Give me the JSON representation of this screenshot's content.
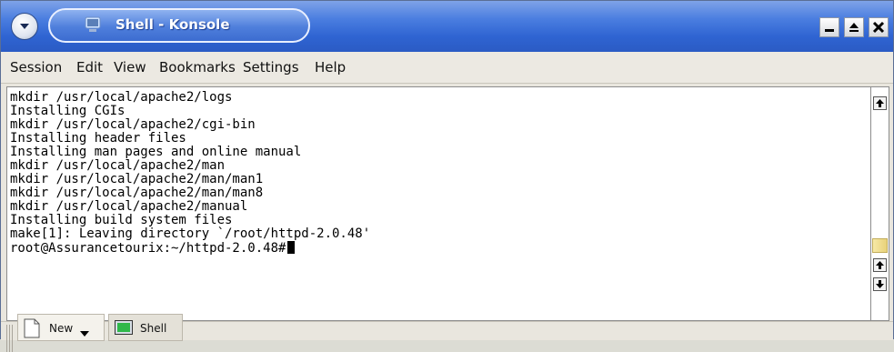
{
  "window": {
    "title": "Shell - Konsole",
    "controls": [
      "minimize",
      "maximize",
      "close"
    ]
  },
  "menu": {
    "items": [
      "Session",
      "Edit",
      "View",
      "Bookmarks",
      "Settings",
      "Help"
    ]
  },
  "terminal": {
    "lines": [
      "mkdir /usr/local/apache2/logs",
      "Installing CGIs",
      "mkdir /usr/local/apache2/cgi-bin",
      "Installing header files",
      "Installing man pages and online manual",
      "mkdir /usr/local/apache2/man",
      "mkdir /usr/local/apache2/man/man1",
      "mkdir /usr/local/apache2/man/man8",
      "mkdir /usr/local/apache2/manual",
      "Installing build system files",
      "make[1]: Leaving directory `/root/httpd-2.0.48'"
    ],
    "prompt": "root@Assurancetourix:~/httpd-2.0.48#"
  },
  "tabs": {
    "new_label": "New",
    "shell_label": "Shell"
  },
  "icons": {
    "menu": "circle-arrow-down-icon",
    "app": "konsole-icon",
    "new": "new-document-icon",
    "shell": "terminal-icon"
  },
  "colors": {
    "titlebar": "#3a6bd4",
    "menubar": "#ece9e2",
    "terminal_bg": "#ffffff",
    "scroll_thumb": "#f0dd8e"
  }
}
